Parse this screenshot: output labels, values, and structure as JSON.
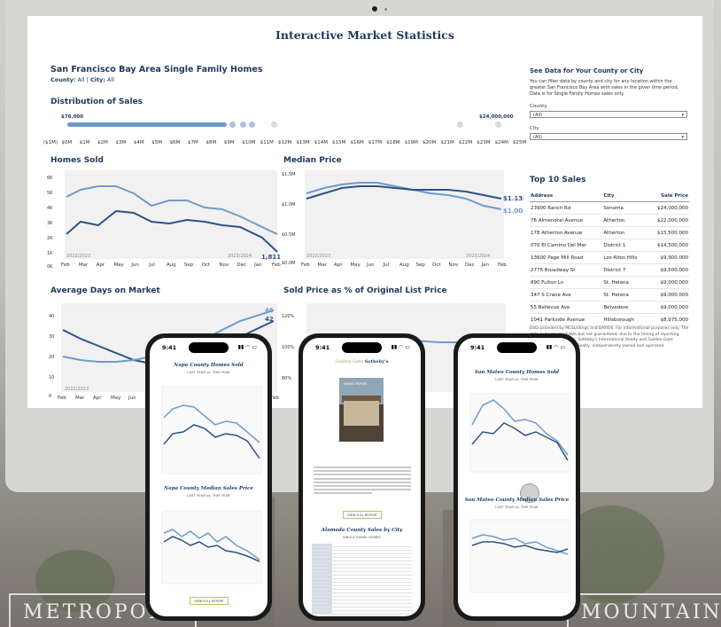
{
  "monitor": {
    "title": "Interactive Market Statistics",
    "heading": "San Francisco Bay Area Single Family Homes",
    "filter_county_label": "County:",
    "filter_county_value": "All",
    "filter_city_label": "City:",
    "filter_city_value": "All",
    "distribution": {
      "title": "Distribution of Sales",
      "min_label": "$78,000",
      "max_label": "$24,000,000",
      "ticks": [
        "($1M)",
        "$0M",
        "$1M",
        "$2M",
        "$3M",
        "$4M",
        "$5M",
        "$6M",
        "$7M",
        "$8M",
        "$9M",
        "$10M",
        "$11M",
        "$12M",
        "$13M",
        "$14M",
        "$15M",
        "$16M",
        "$17M",
        "$18M",
        "$19M",
        "$20M",
        "$21M",
        "$22M",
        "$23M",
        "$24M",
        "$25M"
      ]
    },
    "months": [
      "Feb",
      "Mar",
      "Apr",
      "May",
      "Jun",
      "Jul",
      "Aug",
      "Sep",
      "Oct",
      "Nov",
      "Dec",
      "Jan",
      "Feb"
    ],
    "charts": {
      "homes_sold": {
        "title": "Homes Sold",
        "yticks": [
          "6K",
          "5K",
          "4K",
          "3K",
          "2K",
          "1K",
          "0K"
        ],
        "end_value": "1,811",
        "left_note": "2022/2023",
        "right_note": "2023/2024"
      },
      "median_price": {
        "title": "Median Price",
        "yticks": [
          "$1.5M",
          "$1.0M",
          "$0.5M",
          "$0.0M"
        ],
        "end_value_1": "$1.13M",
        "end_value_2": "$1.00M",
        "left_note": "2022/2023",
        "right_note": "2023/2024"
      },
      "avg_days": {
        "title": "Average Days on Market",
        "yticks": [
          "40",
          "30",
          "20",
          "10",
          "0"
        ],
        "end_value_1": "46",
        "end_value_2": "42",
        "left_note": "2022/2023"
      },
      "pct_list": {
        "title": "Sold Price as % of Original List Price",
        "yticks": [
          "120%",
          "100%",
          "80%"
        ]
      }
    },
    "sidebar": {
      "title": "See Data for Your County or City",
      "description": "You can filter data by county and city for any location within the greater San Francisco Bay Area with sales in the given time period. Data is for Single Family Homes sales only.",
      "county_label": "County",
      "county_value": "(All)",
      "city_label": "City",
      "city_value": "(All)",
      "top10_title": "Top 10 Sales",
      "top10_headers": [
        "Address",
        "City",
        "Sale Price"
      ],
      "top10_rows": [
        [
          "23900 Ranch Rd",
          "Sonoma",
          "$24,000,000"
        ],
        [
          "76 Almendral Avenue",
          "Atherton",
          "$22,000,000"
        ],
        [
          "178 Atherton Avenue",
          "Atherton",
          "$15,500,000"
        ],
        [
          "070 El Camino Del Mar",
          "District 1",
          "$14,500,000"
        ],
        [
          "13600 Page Mill Road",
          "Los Altos Hills",
          "$9,900,000"
        ],
        [
          "2775 Broadway St",
          "District 7",
          "$9,500,000"
        ],
        [
          "890 Fulton Ln",
          "St. Helena",
          "$9,000,000"
        ],
        [
          "347 S Crane Ave",
          "St. Helena",
          "$9,000,000"
        ],
        [
          "55 Bellevue Ave",
          "Belvedere",
          "$9,000,000"
        ],
        [
          "1041 Parkside Avenue",
          "Hillsborough",
          "$8,975,000"
        ]
      ],
      "fine_print": "Data provided by MLSListings and BAREIS. For informational purposes only. The data is deemed reliable but not guaranteed; due to the timing of reporting, MLSs, or other reasons. Sotheby's International Realty and Golden Gate Sotheby's International Realty, independently owned and operated."
    }
  },
  "phones": [
    {
      "time": "9:41",
      "title": "Napa County Homes Sold",
      "subtitle": "LAST YEAR vs. THIS YEAR",
      "title2": "Napa County Median Sales Price",
      "subtitle2": "LAST YEAR vs. THIS YEAR",
      "button": "VIEW FULL REPORT"
    },
    {
      "time": "9:41",
      "brand_1": "Golden",
      "brand_2": "Gate",
      "brand_3": "Sotheby's",
      "cover_text": "MARKET REPORT",
      "button": "VIEW FULL REPORT",
      "table_title": "Alameda County Sales by City",
      "table_subtitle": "SINGLE FAMILY HOMES"
    },
    {
      "time": "9:41",
      "title": "San Mateo County Homes Sold",
      "subtitle": "LAST YEAR vs. THIS YEAR",
      "title2": "San Mateo County Median Sales Price",
      "subtitle2": "LAST YEAR vs. THIS YEAR"
    }
  ],
  "background": {
    "sign_left": "METROPOLITAN",
    "sign_right": "MOUNTAIN"
  },
  "colors": {
    "navy": "#1d3a5c",
    "light_blue": "#6d9ccb",
    "dark_line": "#2d5286",
    "gold": "#c8b56a"
  }
}
